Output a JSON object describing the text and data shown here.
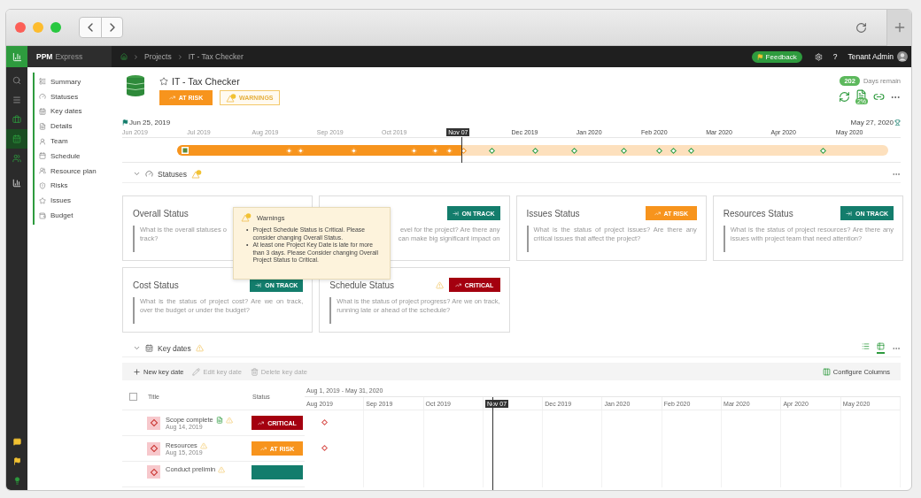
{
  "header": {
    "app_name": "PPM",
    "app_edition": "Express",
    "breadcrumbs": [
      "Projects",
      "IT - Tax Checker"
    ],
    "feedback": "Feedback",
    "help": "?",
    "user": "Tenant Admin"
  },
  "rail": [
    {
      "kind": "search",
      "selected": false
    },
    {
      "kind": "menu",
      "selected": false
    },
    {
      "kind": "projects",
      "selected": false
    },
    {
      "kind": "calendar",
      "selected": true
    },
    {
      "kind": "resources",
      "selected": false
    },
    {
      "kind": "reports",
      "selected": false
    }
  ],
  "rail_bottom": [
    {
      "kind": "chat"
    },
    {
      "kind": "flag"
    },
    {
      "kind": "idea"
    }
  ],
  "nav": [
    {
      "label": "Summary",
      "kind": "summary"
    },
    {
      "label": "Statuses",
      "kind": "statuses"
    },
    {
      "label": "Key dates",
      "kind": "keydates"
    },
    {
      "label": "Details",
      "kind": "details"
    },
    {
      "label": "Team",
      "kind": "team"
    },
    {
      "label": "Schedule",
      "kind": "schedule"
    },
    {
      "label": "Resource plan",
      "kind": "resource"
    },
    {
      "label": "Risks",
      "kind": "risks"
    },
    {
      "label": "Issues",
      "kind": "issues"
    },
    {
      "label": "Budget",
      "kind": "budget"
    }
  ],
  "project": {
    "title": "IT - Tax Checker",
    "favorite": false,
    "status": {
      "label": "AT RISK",
      "kind": "at_risk"
    },
    "warnings_label": "WARNINGS",
    "days_count": "202",
    "days_label": "Days remain",
    "progress": "2%"
  },
  "timeline": {
    "start": "Jun 25, 2019",
    "end": "May 27, 2020",
    "level": 0.4,
    "months": [
      {
        "label": "Jun 2019"
      },
      {
        "label": "Jul 2019"
      },
      {
        "label": "Aug 2019"
      },
      {
        "label": "Sep 2019"
      },
      {
        "label": "Oct 2019"
      },
      {
        "label": "Nov 07",
        "kind": "today"
      },
      {
        "label": "Dec 2019"
      },
      {
        "label": "Jan 2020"
      },
      {
        "label": "Feb 2020"
      },
      {
        "label": "Mar 2020"
      },
      {
        "label": "Apr 2020"
      },
      {
        "label": "May 2020"
      }
    ]
  },
  "statuses": {
    "title": "Statuses",
    "cards": [
      {
        "title": "Overall Status",
        "lines": [
          "What is the overall statuses o",
          "track?"
        ]
      },
      {
        "status": {
          "label": "ON TRACK",
          "kind": "on_track"
        },
        "lines": [
          "evel for the project? Are there any",
          "can make big significant impact on"
        ]
      },
      {
        "title": "Issues Status",
        "status": {
          "label": "AT RISK",
          "kind": "at_risk"
        },
        "lines": [
          "What is the status of project issues? Are there any critical issues that affect the project?"
        ]
      },
      {
        "title": "Resources Status",
        "status": {
          "label": "ON TRACK",
          "kind": "on_track"
        },
        "lines": [
          "What is the status of project resources? Are there any issues with project team that need attention?"
        ]
      },
      {
        "title": "Cost Status",
        "warning": false,
        "status": {
          "label": "ON TRACK",
          "kind": "on_track"
        },
        "lines": [
          "What is the status of project cost? Are we on track, over the budget or under the budget?"
        ]
      },
      {
        "title": "Schedule Status",
        "warning": true,
        "status": {
          "label": "CRITICAL",
          "kind": "critical"
        },
        "lines": [
          "What is the status of project progress? Are we on track, running late or ahead of the schedule?"
        ]
      }
    ]
  },
  "tooltip": {
    "title": "Warnings",
    "items": [
      {
        "bullet": "•",
        "text": "Project Schedule Status is Critical. Please consider changing Overall Status."
      },
      {
        "bullet": "•",
        "text": "At least one Project Key Date is late for more than 3 days. Please Consider changing Overall Project Status to Critical."
      }
    ]
  },
  "key_dates": {
    "title": "Key dates",
    "views": [
      {
        "kind": "list",
        "selected": false
      },
      {
        "kind": "timeline",
        "selected": true
      }
    ],
    "toolbar": [
      {
        "label": "New key date",
        "kind": "add",
        "disabled": false
      },
      {
        "label": "Edit key date",
        "kind": "edit",
        "disabled": true
      },
      {
        "label": "Delete key date",
        "kind": "delete",
        "disabled": true
      }
    ],
    "configure": "Configure Columns",
    "select_all": {
      "checked": false
    },
    "columns": [
      "Title",
      "Status"
    ],
    "range": "Aug 1, 2019 - May 31, 2020",
    "months": [
      {
        "label": "Aug 2019"
      },
      {
        "label": "Sep 2019"
      },
      {
        "label": "Oct 2019"
      },
      {
        "label": "Nov 07",
        "kind": "today"
      },
      {
        "label": "Dec 2019"
      },
      {
        "label": "Jan 2020"
      },
      {
        "label": "Feb 2020"
      },
      {
        "label": "Mar 2020"
      },
      {
        "label": "Apr 2020"
      },
      {
        "label": "May 2020"
      }
    ],
    "rows": [
      {
        "title": "Scope complete",
        "date": "Aug 14, 2019",
        "linked": true,
        "warning": true,
        "status": {
          "label": "CRITICAL",
          "kind": "critical"
        }
      },
      {
        "title": "Resources",
        "date": "Aug 15, 2019",
        "linked": false,
        "warning": true,
        "status": {
          "label": "AT RISK",
          "kind": "at_risk"
        }
      },
      {
        "title": "Conduct prelimin",
        "linked": false,
        "warning": true,
        "status": {
          "kind": "on_track"
        }
      }
    ]
  }
}
